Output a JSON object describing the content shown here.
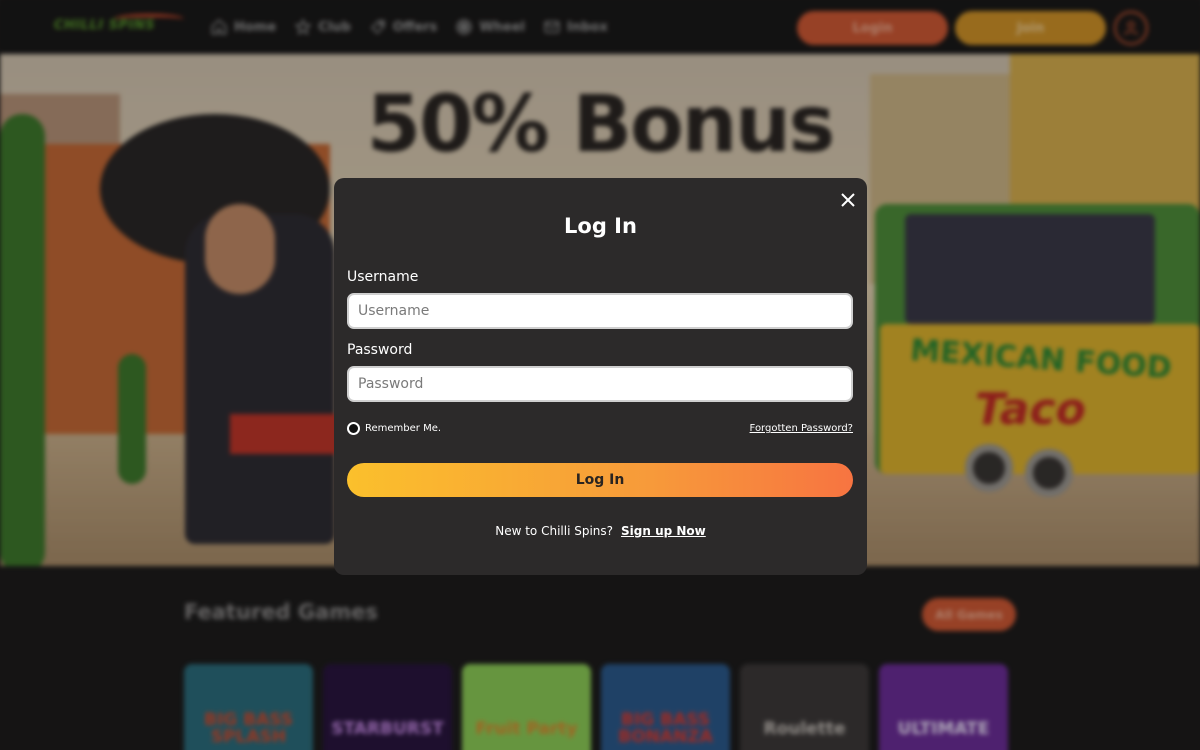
{
  "header": {
    "logo_text": "CHILLI SPINS",
    "nav": [
      {
        "label": "Home",
        "icon": "home-icon"
      },
      {
        "label": "Club",
        "icon": "star-icon"
      },
      {
        "label": "Offers",
        "icon": "tag-icon"
      },
      {
        "label": "Wheel",
        "icon": "wheel-icon"
      },
      {
        "label": "Inbox",
        "icon": "mail-icon"
      }
    ],
    "login_label": "Login",
    "join_label": "Join",
    "avatar_icon": "user-icon"
  },
  "hero": {
    "headline": "50% Bonus",
    "truck_sign_top": "MEXICAN FOOD",
    "truck_sign_bottom": "Taco"
  },
  "featured": {
    "title": "Featured Games",
    "all_games_label": "All Games",
    "games": [
      {
        "name": "BIG BASS SPLASH",
        "color": "#2c6e7e",
        "text_color": "#d84a2b"
      },
      {
        "name": "STARBURST",
        "color": "#2a1640",
        "text_color": "#c98be8"
      },
      {
        "name": "Fruit Party",
        "color": "#8ecf58",
        "text_color": "#e28a2f"
      },
      {
        "name": "BIG BASS BONANZA",
        "color": "#2c5b8e",
        "text_color": "#e23a2d"
      },
      {
        "name": "Roulette",
        "color": "#3e3a3a",
        "text_color": "#c9c3bd"
      },
      {
        "name": "ULTIMATE",
        "color": "#6d2e9a",
        "text_color": "#f1e6ff"
      }
    ]
  },
  "modal": {
    "title": "Log In",
    "username_label": "Username",
    "username_placeholder": "Username",
    "password_label": "Password",
    "password_placeholder": "Password",
    "remember_label": "Remember Me.",
    "forgot_label": "Forgotten Password?",
    "submit_label": "Log In",
    "signup_prompt": "New to Chilli Spins?",
    "signup_link": "Sign up Now"
  },
  "colors": {
    "accent_orange": "#d25a35",
    "accent_yellow": "#d39529",
    "modal_bg": "#2c2a2a",
    "page_bg": "#1e1d1d"
  }
}
